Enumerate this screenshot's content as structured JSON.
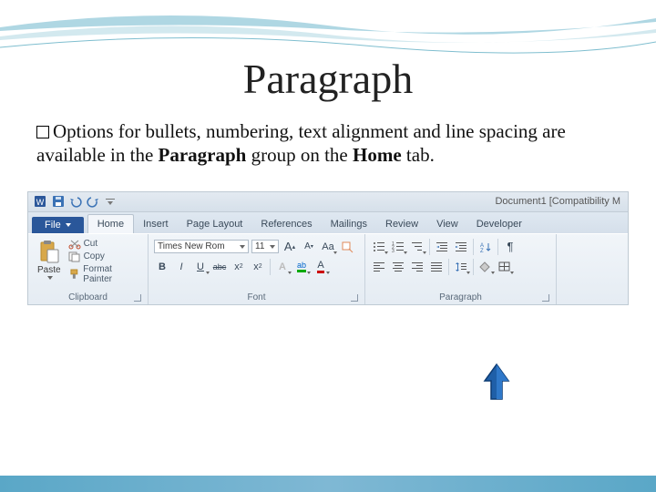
{
  "slide": {
    "title": "Paragraph",
    "body_prefix": "Options for bullets, numbering, text alignment and line spacing are available in the ",
    "body_bold1": "Paragraph",
    "body_mid": " group on the ",
    "body_bold2": "Home",
    "body_suffix": " tab."
  },
  "titlebar": {
    "doc_title": "Document1 [Compatibility M"
  },
  "tabs": {
    "file": "File",
    "items": [
      "Home",
      "Insert",
      "Page Layout",
      "References",
      "Mailings",
      "Review",
      "View",
      "Developer"
    ],
    "active_index": 0
  },
  "clipboard": {
    "paste": "Paste",
    "cut": "Cut",
    "copy": "Copy",
    "format_painter": "Format Painter",
    "label": "Clipboard"
  },
  "font": {
    "name": "Times New Rom",
    "size": "11",
    "label": "Font",
    "bold": "B",
    "italic": "I",
    "underline": "U",
    "strike": "abc",
    "sub": "x",
    "sup": "x",
    "case": "Aa",
    "text_effects": "A",
    "highlight": "ab",
    "font_color": "A"
  },
  "paragraph": {
    "label": "Paragraph",
    "pilcrow": "¶"
  },
  "icons": {
    "word": "word-icon",
    "save": "save-icon",
    "undo": "undo-icon",
    "redo": "redo-icon"
  }
}
